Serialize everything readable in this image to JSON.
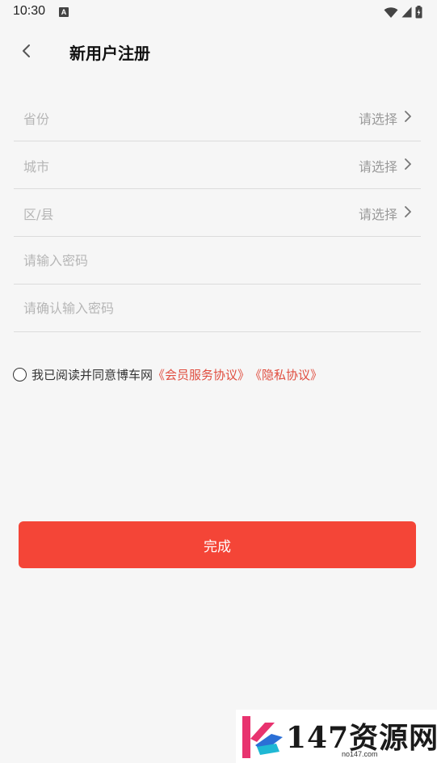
{
  "status_bar": {
    "time": "10:30",
    "indicator": "A",
    "icons": [
      "wifi-icon",
      "signal-icon",
      "battery-icon"
    ]
  },
  "header": {
    "title": "新用户注册",
    "back_icon": "chevron-left-icon"
  },
  "form": {
    "province": {
      "label": "省份",
      "hint": "请选择"
    },
    "city": {
      "label": "城市",
      "hint": "请选择"
    },
    "district": {
      "label": "区/县",
      "hint": "请选择"
    },
    "password": {
      "placeholder": "请输入密码"
    },
    "confirm_password": {
      "placeholder": "请确认输入密码"
    }
  },
  "agreement": {
    "text": "我已阅读并同意博车网",
    "member_link": "《会员服务协议》",
    "privacy_link": "《隐私协议》",
    "checked": false
  },
  "submit": {
    "label": "完成"
  },
  "watermark": {
    "brand": "147资源网",
    "url": "no147.com"
  },
  "colors": {
    "accent": "#f44537",
    "link": "#e04d3f",
    "background": "#f6f6f6",
    "placeholder": "#b6b6b6"
  }
}
